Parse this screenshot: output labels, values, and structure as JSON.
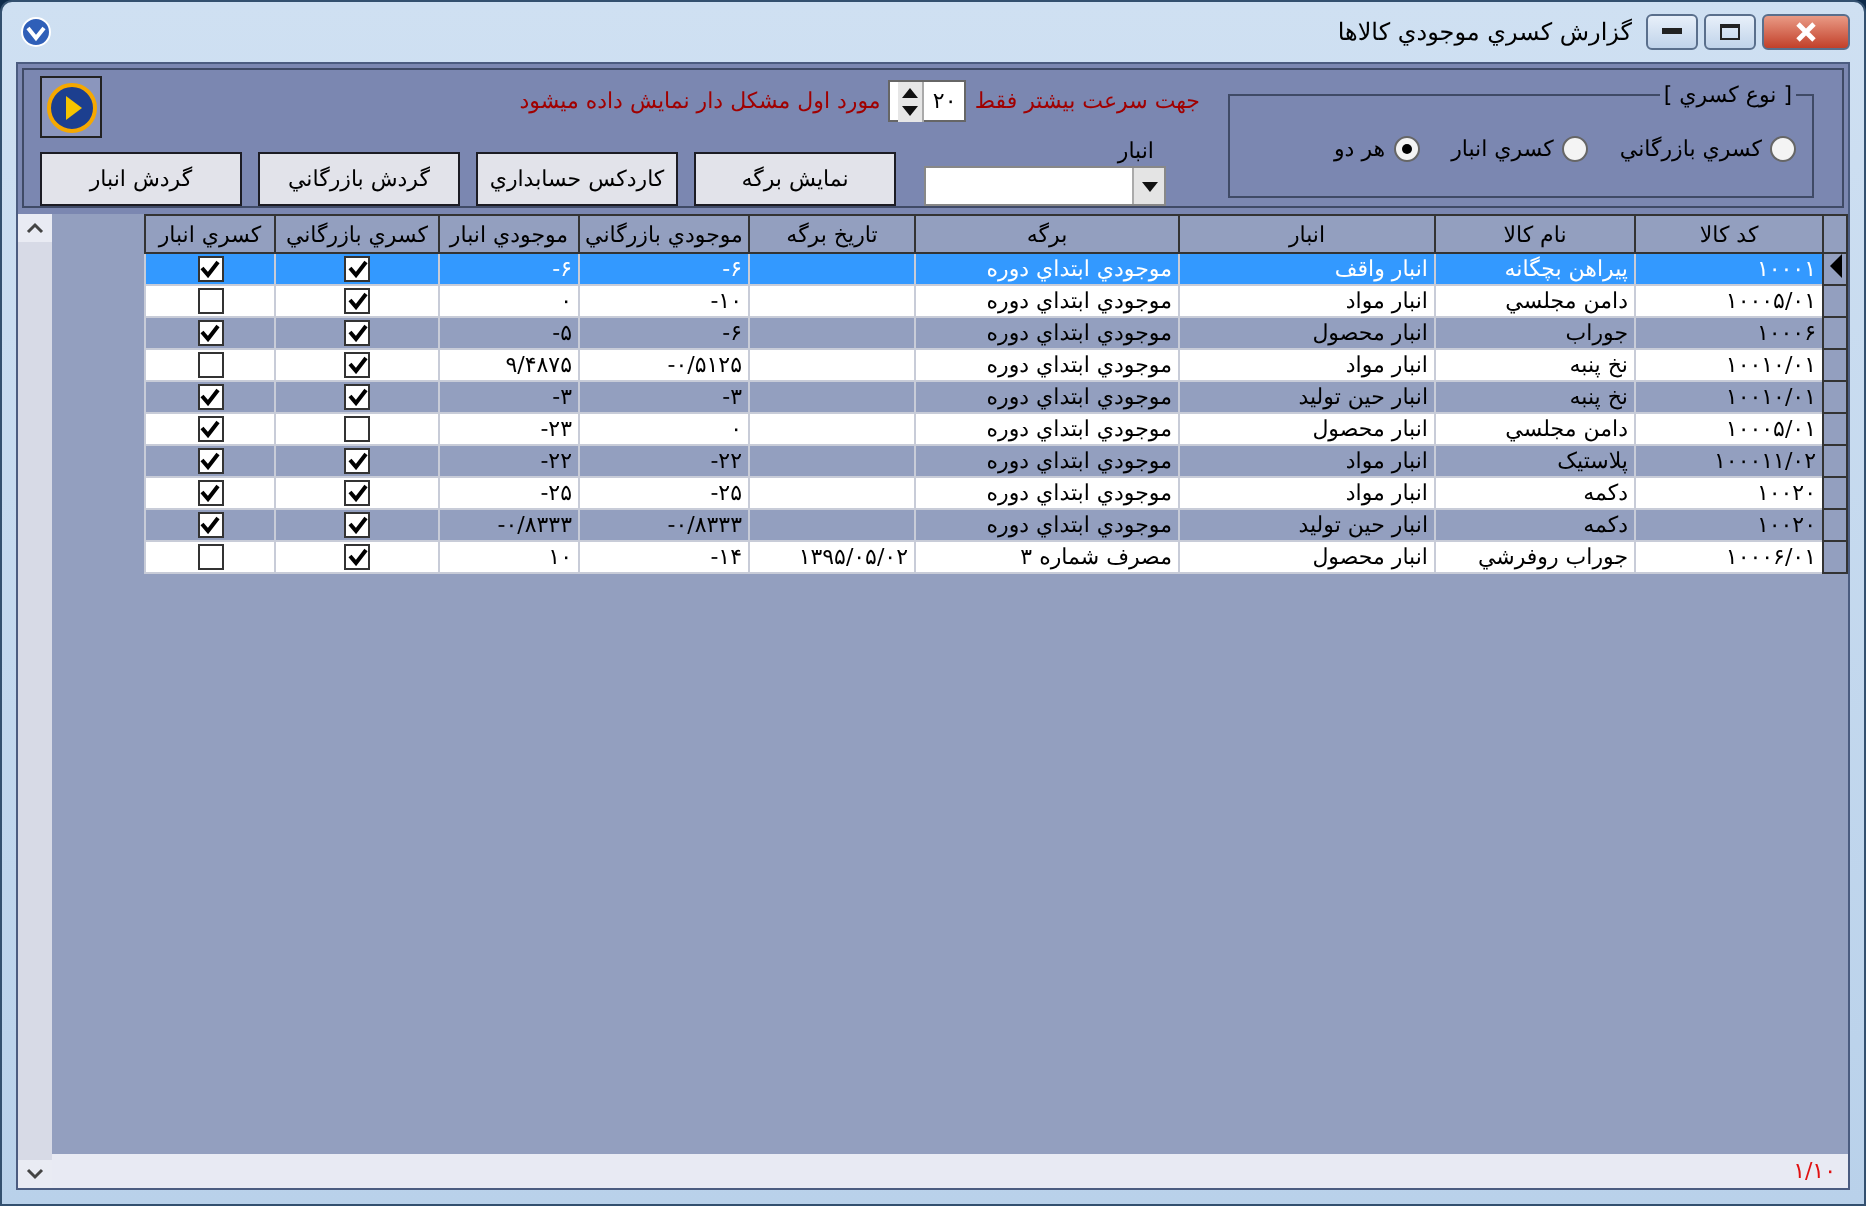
{
  "window": {
    "title": "گزارش کسري موجودي کالاها"
  },
  "filter": {
    "legend": "[ نوع کسري ]",
    "options": [
      {
        "label": "کسري بازرگاني",
        "selected": false
      },
      {
        "label": "کسري انبار",
        "selected": false
      },
      {
        "label": "هر دو",
        "selected": true
      }
    ]
  },
  "notice": {
    "before": "جهت سرعت بيشتر فقط",
    "count": "۲۰",
    "after": "مورد اول مشکل دار نمايش داده ميشود"
  },
  "warehouse": {
    "label": "انبار"
  },
  "buttons": [
    "نمايش برگه",
    "کاردکس حسابداري",
    "گردش بازرگاني",
    "گردش انبار"
  ],
  "table": {
    "columns": [
      {
        "label": "کد کالا",
        "kind": "number"
      },
      {
        "label": "نام کالا",
        "kind": "text"
      },
      {
        "label": "انبار",
        "kind": "text"
      },
      {
        "label": "برگه",
        "kind": "text"
      },
      {
        "label": "تاريخ برگه",
        "kind": "number"
      },
      {
        "label": "موجودي بازرگاني",
        "kind": "number"
      },
      {
        "label": "موجودي انبار",
        "kind": "number"
      },
      {
        "label": "کسري بازرگاني",
        "kind": "check"
      },
      {
        "label": "کسري انبار",
        "kind": "check"
      }
    ],
    "rows": [
      {
        "selected": true,
        "cells": [
          "۱۰۰۰۱",
          "پيراهن بچگانه",
          "انبار واقف",
          "موجودي ابتداي دوره",
          null,
          "-۶",
          "-۶",
          true,
          true
        ]
      },
      {
        "selected": false,
        "cells": [
          "۱۰۰۰۵/۰۱",
          "دامن مجلسي",
          "انبار مواد",
          "موجودي ابتداي دوره",
          null,
          "-۱۰",
          "۰",
          true,
          false
        ]
      },
      {
        "selected": false,
        "cells": [
          "۱۰۰۰۶",
          "جوراب",
          "انبار محصول",
          "موجودي ابتداي دوره",
          null,
          "-۶",
          "-۵",
          true,
          true
        ]
      },
      {
        "selected": false,
        "cells": [
          "۱۰۰۱۰/۰۱",
          "نخ پنبه",
          "انبار مواد",
          "موجودي ابتداي دوره",
          null,
          "-۰/۵۱۲۵",
          "۹/۴۸۷۵",
          true,
          false
        ]
      },
      {
        "selected": false,
        "cells": [
          "۱۰۰۱۰/۰۱",
          "نخ پنبه",
          "انبار حين توليد",
          "موجودي ابتداي دوره",
          null,
          "-۳",
          "-۳",
          true,
          true
        ]
      },
      {
        "selected": false,
        "cells": [
          "۱۰۰۰۵/۰۱",
          "دامن مجلسي",
          "انبار محصول",
          "موجودي ابتداي دوره",
          null,
          "۰",
          "-۲۳",
          false,
          true
        ]
      },
      {
        "selected": false,
        "cells": [
          "۱۰۰۰۱۱/۰۲",
          "پلاستيک",
          "انبار مواد",
          "موجودي ابتداي دوره",
          null,
          "-۲۲",
          "-۲۲",
          true,
          true
        ]
      },
      {
        "selected": false,
        "cells": [
          "۱۰۰۲۰",
          "دکمه",
          "انبار مواد",
          "موجودي ابتداي دوره",
          null,
          "-۲۵",
          "-۲۵",
          true,
          true
        ]
      },
      {
        "selected": false,
        "cells": [
          "۱۰۰۲۰",
          "دکمه",
          "انبار حين توليد",
          "موجودي ابتداي دوره",
          null,
          "-۰/۸۳۳۳",
          "-۰/۸۳۳۳",
          true,
          true
        ]
      },
      {
        "selected": false,
        "cells": [
          "۱۰۰۰۶/۰۱",
          "جوراب  روفرشي",
          "انبار محصول",
          "مصرف شماره ۳",
          "۱۳۹۵/۰۵/۰۲",
          "-۱۴",
          "۱۰",
          true,
          false
        ]
      }
    ]
  },
  "status": {
    "record": "۱/۱۰"
  }
}
